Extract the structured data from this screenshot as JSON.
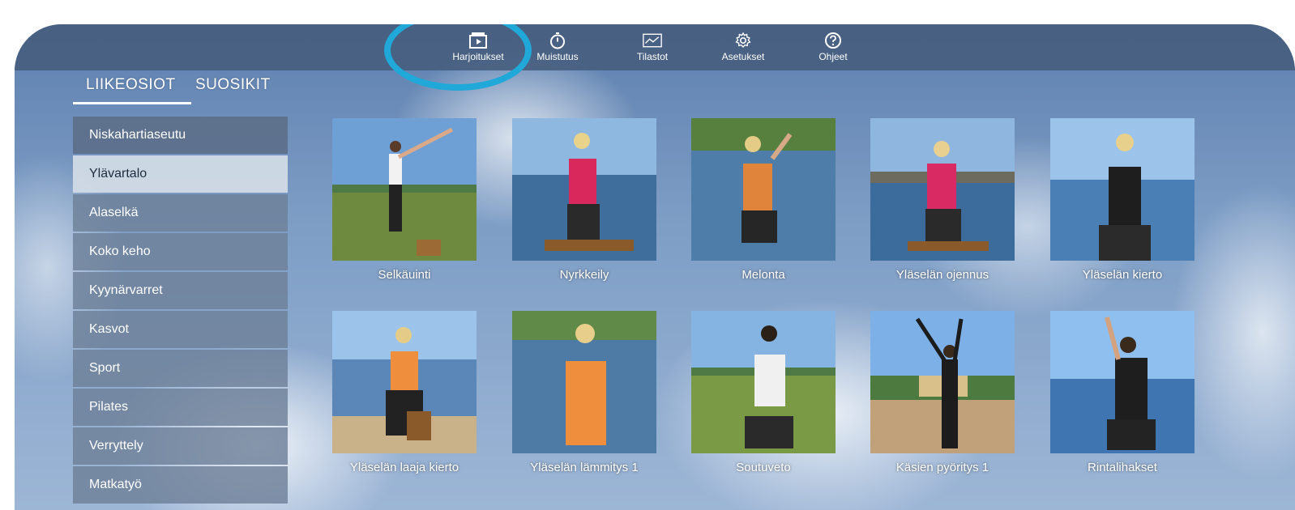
{
  "nav": {
    "items": [
      {
        "label": "Harjoitukset",
        "icon": "play-folder-icon"
      },
      {
        "label": "Muistutus",
        "icon": "stopwatch-icon"
      },
      {
        "label": "Tilastot",
        "icon": "chart-icon"
      },
      {
        "label": "Asetukset",
        "icon": "gear-icon"
      },
      {
        "label": "Ohjeet",
        "icon": "help-icon"
      }
    ]
  },
  "tabs": {
    "liikeosiot": "LIIKEOSIOT",
    "suosikit": "SUOSIKIT"
  },
  "sidebar": {
    "items": [
      {
        "label": "Niskahartiaseutu"
      },
      {
        "label": "Ylävartalo"
      },
      {
        "label": "Alaselkä"
      },
      {
        "label": "Koko keho"
      },
      {
        "label": "Kyynärvarret"
      },
      {
        "label": "Kasvot"
      },
      {
        "label": "Sport"
      },
      {
        "label": "Pilates"
      },
      {
        "label": "Verryttely"
      },
      {
        "label": "Matkatyö"
      }
    ]
  },
  "exercises": [
    {
      "title": "Selkäuinti"
    },
    {
      "title": "Nyrkkeily"
    },
    {
      "title": "Melonta"
    },
    {
      "title": "Yläselän ojennus"
    },
    {
      "title": "Yläselän kierto"
    },
    {
      "title": "Yläselän laaja kierto"
    },
    {
      "title": "Yläselän lämmitys 1"
    },
    {
      "title": "Soutuveto"
    },
    {
      "title": "Käsien pyöritys 1"
    },
    {
      "title": "Rintalihakset"
    }
  ],
  "colors": {
    "highlight_ring": "#1fa8d8",
    "topbar": "#465c7c",
    "sidebar_item": "#6e8098",
    "sidebar_selected": "#d6dee8"
  }
}
